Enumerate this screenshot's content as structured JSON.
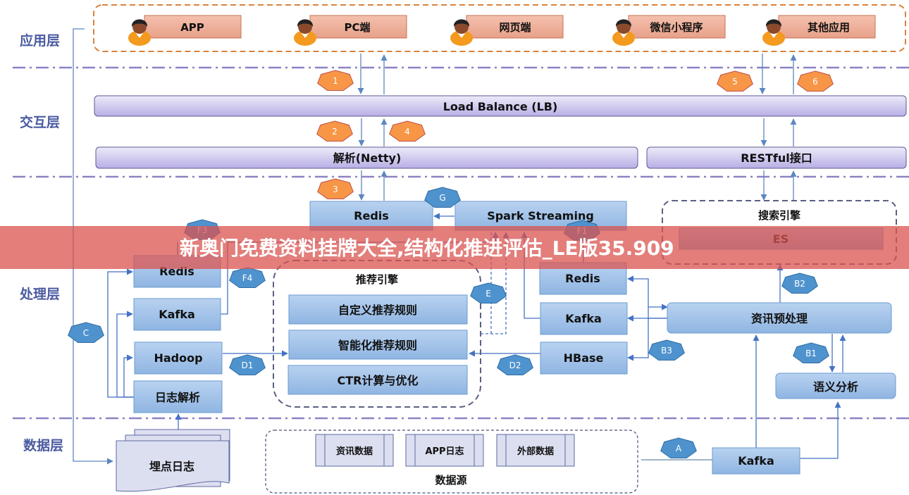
{
  "layers": [
    {
      "id": "app",
      "label": "应用层"
    },
    {
      "id": "interaction",
      "label": "交互层"
    },
    {
      "id": "processing",
      "label": "处理层"
    },
    {
      "id": "data",
      "label": "数据层"
    }
  ],
  "application_layer": {
    "clients": [
      {
        "label": "APP",
        "icon": "user-avatar-icon"
      },
      {
        "label": "PC端",
        "icon": "user-avatar-icon"
      },
      {
        "label": "网页端",
        "icon": "user-avatar-icon"
      },
      {
        "label": "微信小程序",
        "icon": "user-avatar-icon"
      },
      {
        "label": "其他应用",
        "icon": "user-avatar-icon"
      }
    ]
  },
  "interaction_layer": {
    "load_balance": "Load Balance (LB)",
    "netty": "解析(Netty)",
    "restful": "RESTful接口"
  },
  "processing_layer": {
    "redis_top": "Redis",
    "spark_streaming": "Spark Streaming",
    "search_engine": {
      "title": "搜索引擎",
      "es": "ES"
    },
    "left_stack": [
      "Redis",
      "Kafka",
      "Hadoop",
      "日志解析"
    ],
    "recommend_engine": {
      "title": "推荐引擎",
      "rules": [
        "自定义推荐规则",
        "智能化推荐规则",
        "CTR计算与优化"
      ]
    },
    "right_stack": [
      "Redis",
      "Kafka",
      "HBase"
    ],
    "news_preprocess": "资讯预处理",
    "semantic_analysis": "语义分析"
  },
  "data_layer": {
    "tracking_log": "埋点日志",
    "data_source": {
      "title": "数据源",
      "items": [
        "资讯数据",
        "APP日志",
        "外部数据"
      ]
    },
    "kafka": "Kafka"
  },
  "step_badges": {
    "orange": [
      "1",
      "2",
      "3",
      "4",
      "5",
      "6"
    ],
    "blue": [
      "G",
      "F3",
      "F4",
      "F1",
      "E",
      "C",
      "D1",
      "D2",
      "B1",
      "B2",
      "B3",
      "A"
    ]
  },
  "colors": {
    "layer_label": "#4a5aa0",
    "orange_badge": "#f79646",
    "blue_badge": "#4f93ce",
    "box_fill": "#a4c2e8",
    "bar_fill": "#c9c0ea",
    "app_fill": "#eeae98",
    "banner": "#d9534f"
  },
  "watermark_banner": "新奥门免费资料挂牌大全,结构化推进评估_LE版35.909"
}
